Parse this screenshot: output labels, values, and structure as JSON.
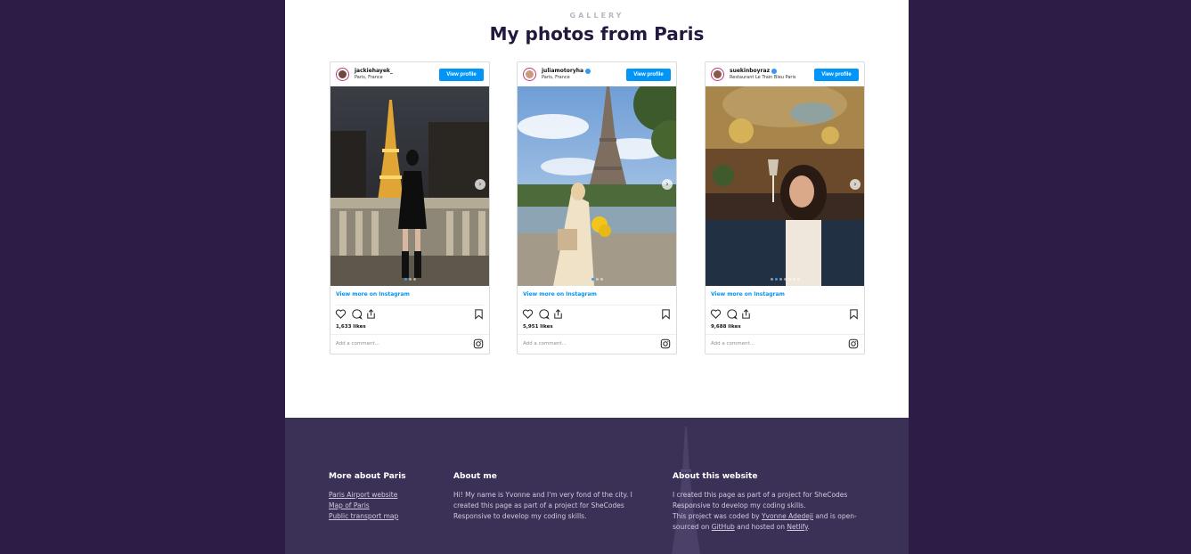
{
  "gallery": {
    "eyebrow": "GALLERY",
    "title": "My photos from Paris",
    "posts": [
      {
        "username": "jackiehayek_",
        "verified": false,
        "location": "Paris, France",
        "view_profile": "View profile",
        "view_more": "View more on Instagram",
        "likes": "1,633 likes",
        "comment_placeholder": "Add a comment...",
        "carousel_dots": 3,
        "active_dot": 0
      },
      {
        "username": "juliamotoryha",
        "verified": true,
        "location": "Paris, France",
        "view_profile": "View profile",
        "view_more": "View more on Instagram",
        "likes": "5,951 likes",
        "comment_placeholder": "Add a comment...",
        "carousel_dots": 3,
        "active_dot": 0
      },
      {
        "username": "suekinboyraz",
        "verified": true,
        "location": "Restaurant Le Train Bleu Paris",
        "view_profile": "View profile",
        "view_more": "View more on Instagram",
        "likes": "9,688 likes",
        "comment_placeholder": "Add a comment...",
        "carousel_dots": 7,
        "active_dot": 1
      }
    ]
  },
  "footer": {
    "more": {
      "heading": "More about Paris",
      "links": [
        "Paris Airport website",
        "Map of Paris",
        "Public transport map"
      ]
    },
    "about_me": {
      "heading": "About me",
      "text": "Hi! My name is Yvonne and I'm very fond of the city. I created this page as part of a project for SheCodes Responsive to develop my coding skills."
    },
    "about_site": {
      "heading": "About this website",
      "line1": "I created this page as part of a project for SheCodes Responsive to develop my coding skills.",
      "line2_a": "This project was coded by ",
      "author_link": "Yvonne Adedeji",
      "line2_b": " and is open-sourced on ",
      "github_link": "GitHub",
      "line2_c": " and hosted on ",
      "netlify_link": "Netlify",
      "line2_d": "."
    }
  },
  "colors": {
    "background": "#2b1d45",
    "footer": "#3b3157",
    "instagram_blue": "#0095f6",
    "title": "#23183e"
  }
}
